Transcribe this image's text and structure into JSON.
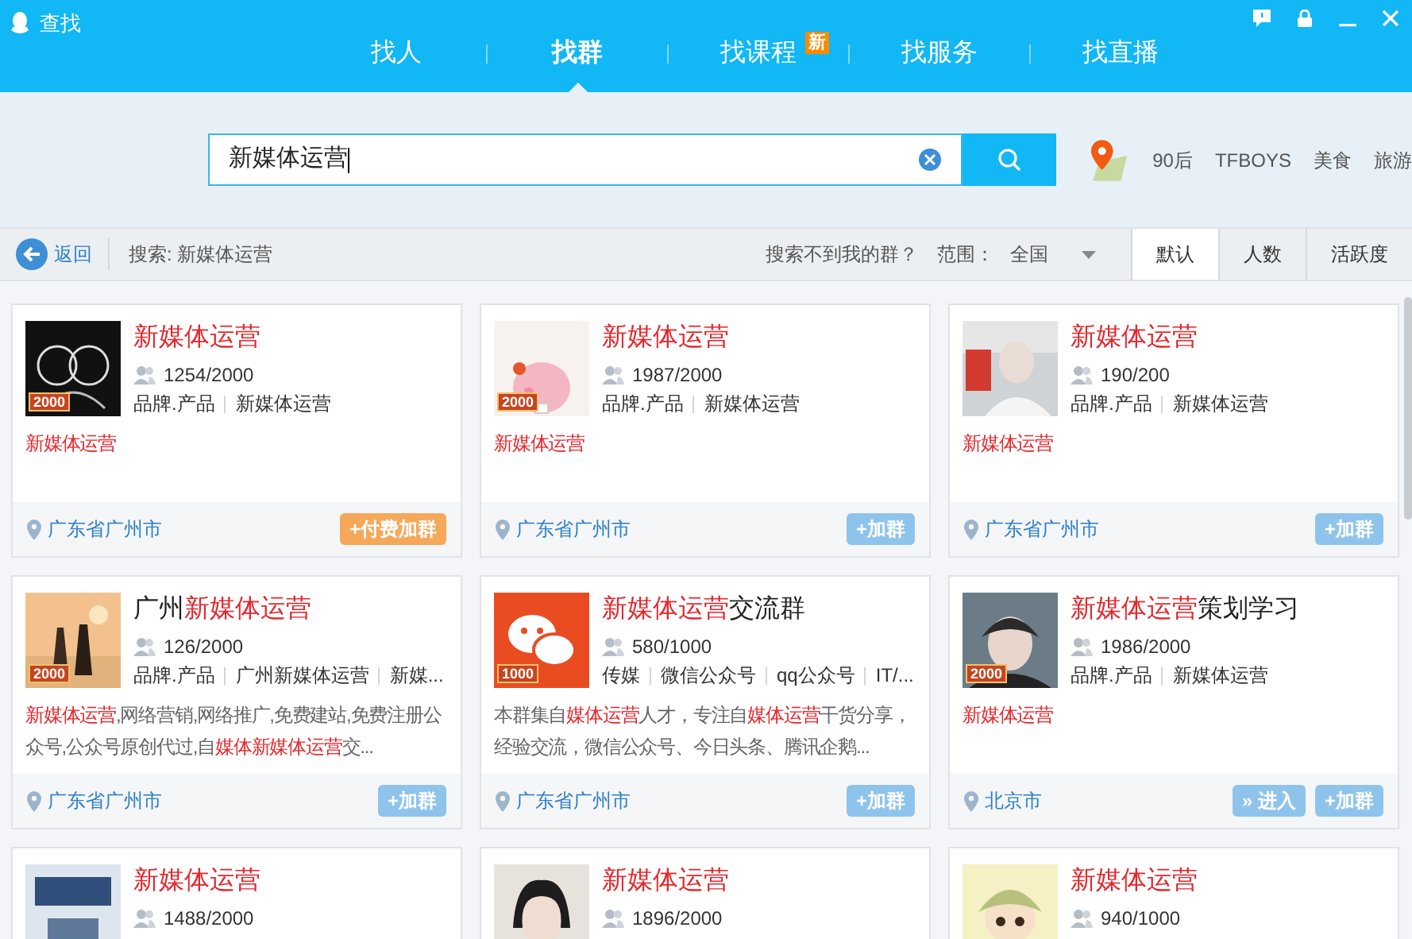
{
  "window": {
    "title": "查找"
  },
  "tabs": [
    {
      "label": "找人",
      "selected": false
    },
    {
      "label": "找群",
      "selected": true
    },
    {
      "label": "找课程",
      "selected": false,
      "badge": "新"
    },
    {
      "label": "找服务",
      "selected": false
    },
    {
      "label": "找直播",
      "selected": false
    }
  ],
  "search": {
    "value": "新媒体运营",
    "hot_tags": [
      "90后",
      "TFBOYS",
      "美食",
      "旅游"
    ]
  },
  "filter_bar": {
    "back": "返回",
    "query": "搜索: 新媒体运营",
    "not_found": "搜索不到我的群？",
    "range_label": "范围：",
    "range_value": "全国",
    "sort_tabs": [
      {
        "label": "默认",
        "selected": true
      },
      {
        "label": "人数",
        "selected": false
      },
      {
        "label": "活跃度",
        "selected": false
      }
    ]
  },
  "groups": [
    {
      "name": [
        {
          "text": "新媒体运营",
          "highlight": true
        }
      ],
      "badge": "2000",
      "members": "1254/2000",
      "tags": [
        "品牌.产品",
        "新媒体运营"
      ],
      "desc": [
        {
          "text": "新媒体运营",
          "highlight": true
        }
      ],
      "location": "广东省广州市",
      "buttons": [
        {
          "kind": "paid",
          "label": "+付费加群"
        }
      ]
    },
    {
      "name": [
        {
          "text": "新媒体运营",
          "highlight": true
        }
      ],
      "badge": "2000",
      "members": "1987/2000",
      "tags": [
        "品牌.产品",
        "新媒体运营"
      ],
      "desc": [
        {
          "text": "新媒体运营",
          "highlight": true
        }
      ],
      "location": "广东省广州市",
      "buttons": [
        {
          "kind": "join",
          "label": "+加群"
        }
      ]
    },
    {
      "name": [
        {
          "text": "新媒体运营",
          "highlight": true
        }
      ],
      "members": "190/200",
      "tags": [
        "品牌.产品",
        "新媒体运营"
      ],
      "desc": [
        {
          "text": "新媒体运营",
          "highlight": true
        }
      ],
      "location": "广东省广州市",
      "buttons": [
        {
          "kind": "join",
          "label": "+加群"
        }
      ]
    },
    {
      "name": [
        {
          "text": "广州",
          "highlight": false
        },
        {
          "text": "新媒体运营",
          "highlight": true
        }
      ],
      "badge": "2000",
      "members": "126/2000",
      "tags": [
        "品牌.产品",
        "广州新媒体运营",
        "新媒..."
      ],
      "desc": [
        {
          "text": "新媒体运营",
          "highlight": true
        },
        {
          "text": ",网络营销,网络推广,免费建站,免费注册公众号,公众号原创代过,自",
          "highlight": false
        },
        {
          "text": "媒体新媒体运营",
          "highlight": true
        },
        {
          "text": "交...",
          "highlight": false
        }
      ],
      "location": "广东省广州市",
      "buttons": [
        {
          "kind": "join",
          "label": "+加群"
        }
      ]
    },
    {
      "name": [
        {
          "text": "新媒体运营",
          "highlight": true
        },
        {
          "text": "交流群",
          "highlight": false
        }
      ],
      "badge": "1000",
      "members": "580/1000",
      "tags": [
        "传媒",
        "微信公众号",
        "qq公众号",
        "IT/..."
      ],
      "desc": [
        {
          "text": "本群集自",
          "highlight": false
        },
        {
          "text": "媒体运营",
          "highlight": true
        },
        {
          "text": "人才，专注自",
          "highlight": false
        },
        {
          "text": "媒体运营",
          "highlight": true
        },
        {
          "text": "干货分享，经验交流，微信公众号、今日头条、腾讯企鹅...",
          "highlight": false
        }
      ],
      "location": "广东省广州市",
      "buttons": [
        {
          "kind": "join",
          "label": "+加群"
        }
      ]
    },
    {
      "name": [
        {
          "text": "新媒体运营",
          "highlight": true
        },
        {
          "text": "策划学习",
          "highlight": false
        }
      ],
      "badge": "2000",
      "members": "1986/2000",
      "tags": [
        "品牌.产品",
        "新媒体运营"
      ],
      "desc": [
        {
          "text": "新媒体运营",
          "highlight": true
        }
      ],
      "location": "北京市",
      "buttons": [
        {
          "kind": "enter",
          "label": "» 进入"
        },
        {
          "kind": "join",
          "label": "+加群"
        }
      ]
    },
    {
      "name": [
        {
          "text": "新媒体运营",
          "highlight": true
        }
      ],
      "members": "1488/2000"
    },
    {
      "name": [
        {
          "text": "新媒体运营",
          "highlight": true
        }
      ],
      "members": "1896/2000"
    },
    {
      "name": [
        {
          "text": "新媒体运营",
          "highlight": true
        }
      ],
      "members": "940/1000"
    }
  ]
}
